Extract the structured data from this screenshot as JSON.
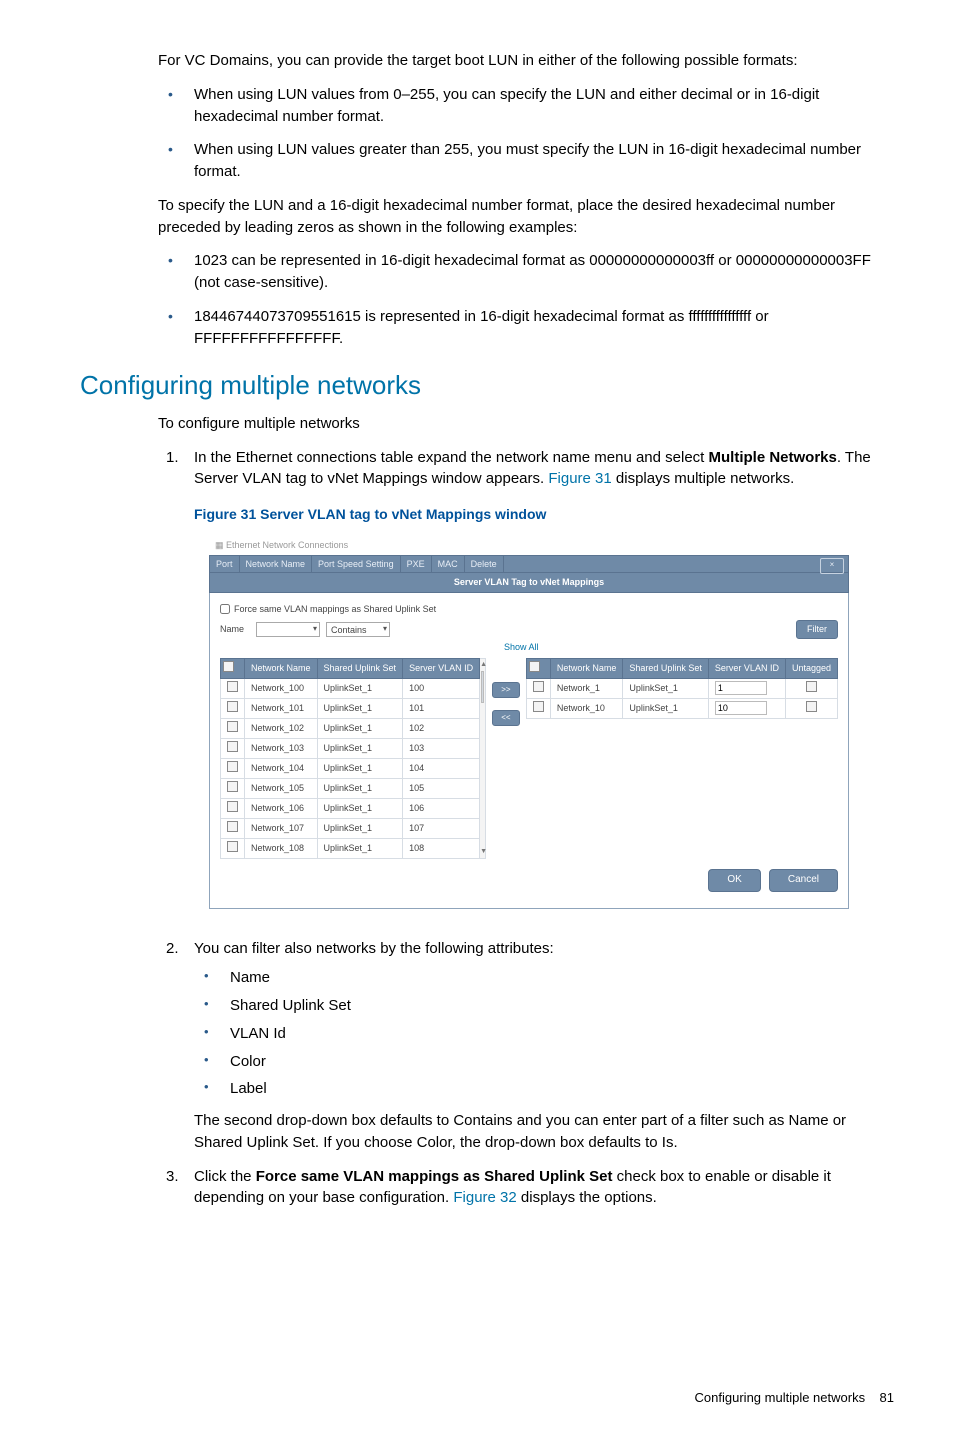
{
  "intro": {
    "p1": "For VC Domains, you can provide the target boot LUN in either of the following possible formats:",
    "b1": "When using LUN values from 0–255, you can specify the LUN and either decimal or in 16-digit hexadecimal number format.",
    "b2": "When using LUN values greater than 255, you must specify the LUN in 16-digit hexadecimal number format.",
    "p2": "To specify the LUN and a 16-digit hexadecimal number format, place the desired hexadecimal number preceded by leading zeros as shown in the following examples:",
    "b3": "1023 can be represented in 16-digit hexadecimal format as 00000000000003ff or 00000000000003FF (not case-sensitive).",
    "b4": "18446744073709551615 is represented in 16-digit hexadecimal format as ffffffffffffffff or FFFFFFFFFFFFFFFF."
  },
  "heading": "Configuring multiple networks",
  "lead": "To configure multiple networks",
  "step1_a": "In the Ethernet connections table expand the network name menu and select ",
  "step1_b": "Multiple Networks",
  "step1_c": ". The Server VLAN tag to vNet Mappings window appears. ",
  "step1_link": "Figure 31",
  "step1_d": " displays multiple networks.",
  "figcaption": "Figure 31 Server VLAN tag to vNet Mappings window",
  "fig": {
    "winlabel": "Ethernet Network Connections",
    "tabs": [
      "Port",
      "Network Name",
      "Port Speed Setting",
      "PXE",
      "MAC",
      "Delete"
    ],
    "subtitle": "Server VLAN Tag to vNet Mappings",
    "force_label": "Force same VLAN mappings as Shared Uplink Set",
    "filter_name": "Name",
    "filter_contains": "Contains",
    "filter_btn": "Filter",
    "showall": "Show All",
    "left_headers": [
      "Network Name",
      "Shared Uplink Set",
      "Server VLAN ID"
    ],
    "left_rows": [
      {
        "name": "Network_100",
        "sus": "UplinkSet_1",
        "vlan": "100"
      },
      {
        "name": "Network_101",
        "sus": "UplinkSet_1",
        "vlan": "101"
      },
      {
        "name": "Network_102",
        "sus": "UplinkSet_1",
        "vlan": "102"
      },
      {
        "name": "Network_103",
        "sus": "UplinkSet_1",
        "vlan": "103"
      },
      {
        "name": "Network_104",
        "sus": "UplinkSet_1",
        "vlan": "104"
      },
      {
        "name": "Network_105",
        "sus": "UplinkSet_1",
        "vlan": "105"
      },
      {
        "name": "Network_106",
        "sus": "UplinkSet_1",
        "vlan": "106"
      },
      {
        "name": "Network_107",
        "sus": "UplinkSet_1",
        "vlan": "107"
      },
      {
        "name": "Network_108",
        "sus": "UplinkSet_1",
        "vlan": "108"
      }
    ],
    "right_headers": [
      "Network Name",
      "Shared Uplink Set",
      "Server VLAN ID",
      "Untagged"
    ],
    "right_rows": [
      {
        "name": "Network_1",
        "sus": "UplinkSet_1",
        "vlan": "1"
      },
      {
        "name": "Network_10",
        "sus": "UplinkSet_1",
        "vlan": "10"
      }
    ],
    "ok": "OK",
    "cancel": "Cancel"
  },
  "step2_intro": "You can filter also networks by the following attributes:",
  "step2_items": [
    "Name",
    "Shared Uplink Set",
    "VLAN Id",
    "Color",
    "Label"
  ],
  "step2_tail": "The second drop-down box defaults to Contains and you can enter part of a filter such as Name or Shared Uplink Set. If you choose Color, the drop-down box defaults to Is.",
  "step3_a": "Click the ",
  "step3_b": "Force same VLAN mappings as Shared Uplink Set",
  "step3_c": " check box to enable or disable it depending on your base configuration. ",
  "step3_link": "Figure 32",
  "step3_d": " displays the options.",
  "footer_label": "Configuring multiple networks",
  "footer_page": "81"
}
